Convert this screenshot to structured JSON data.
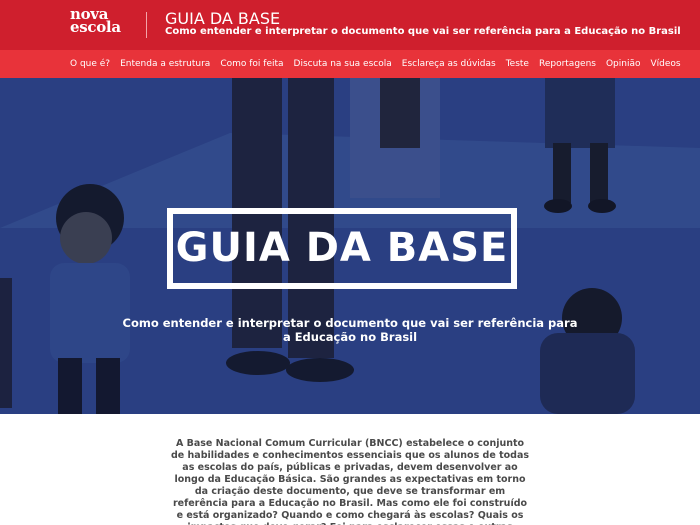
{
  "header": {
    "logo": [
      "nova",
      "escola"
    ],
    "title": "GUIA DA BASE",
    "subtitle": "Como entender e interpretar o documento que vai ser referência para a Educação no Brasil"
  },
  "nav": {
    "items": [
      "O que é?",
      "Entenda a estrutura",
      "Como foi feita",
      "Discuta na sua escola",
      "Esclareça as dúvidas",
      "Teste",
      "Reportagens",
      "Opinião",
      "Vídeos"
    ]
  },
  "hero": {
    "title": "GUIA DA BASE",
    "subtitle": "Como entender e interpretar o documento que vai ser referência para a Educação no Brasil"
  },
  "intro": {
    "text": "A Base Nacional Comum Curricular (BNCC) estabelece o conjunto de habilidades e conhecimentos essenciais que os alunos de todas as escolas do país, públicas e privadas, devem desenvolver ao longo da Educação Básica. São grandes as expectativas em torno da criação deste documento, que deve se transformar em referência para a Educação no Brasil. Mas como ele foi construído e está organizado? Quando e como chegará às escolas? Quais os impactos que deve gerar? Foi para esclarecer essas e outras questões que preparamos um Guia sobre o assunto."
  },
  "colors": {
    "header_red": "#cf1f2d",
    "nav_red": "#e8333a",
    "hero_blue": "#2a3f82"
  }
}
